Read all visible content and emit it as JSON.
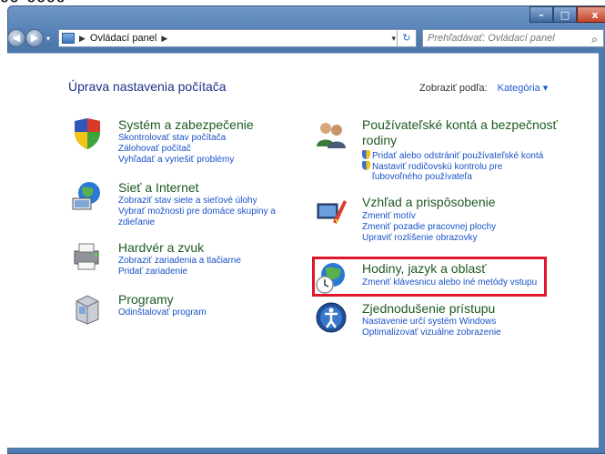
{
  "window": {
    "caption": {
      "minimize": "–",
      "maximize": "□",
      "close": "x"
    }
  },
  "navigation": {
    "back_icon": "◀",
    "forward_icon": "▶",
    "breadcrumb_root_label": "Ovládací panel",
    "refresh_icon": "↻",
    "search_placeholder": "Prehľadávať: Ovládací panel",
    "search_icon": "⌕"
  },
  "main": {
    "heading": "Úprava nastavenia počítača",
    "view_by_label": "Zobraziť podľa:",
    "view_by_value": "Kategória ▾"
  },
  "left_column": [
    {
      "title": "Systém a zabezpečenie",
      "links": [
        "Skontrolovať stav počítača",
        "Zálohovať počítač",
        "Vyhľadať a vyriešiť problémy"
      ]
    },
    {
      "title": "Sieť a Internet",
      "links": [
        "Zobraziť stav siete a sieťové úlohy",
        "Vybrať možnosti pre domáce skupiny a",
        "zdieľanie"
      ]
    },
    {
      "title": "Hardvér a zvuk",
      "links": [
        "Zobraziť zariadenia a tlačiarne",
        "Pridať zariadenie"
      ]
    },
    {
      "title": "Programy",
      "links": [
        "Odinštalovať program"
      ]
    }
  ],
  "right_column": [
    {
      "title_line1": "Používateľské kontá a bezpečnosť",
      "title_line2": "rodiny",
      "links": [
        "Pridať alebo odstrániť používateľské kontá",
        "Nastaviť rodičovskú kontrolu pre",
        "ľubovoľného používateľa"
      ]
    },
    {
      "title": "Vzhľad a prispôsobenie",
      "links": [
        "Zmeniť motív",
        "Zmeniť pozadie pracovnej plochy",
        "Upraviť rozlíšenie obrazovky"
      ]
    },
    {
      "title": "Hodiny, jazyk a oblasť",
      "links": [
        "Zmeniť klávesnicu alebo iné metódy vstupu"
      ]
    },
    {
      "title": "Zjednodušenie prístupu",
      "links": [
        "Nastavenie určí systém Windows",
        "Optimalizovať vizuálne zobrazenie"
      ]
    }
  ],
  "colors": {
    "title_green": "#1e5a22",
    "link_blue": "#1852c8",
    "highlight_red": "#e0162b"
  }
}
